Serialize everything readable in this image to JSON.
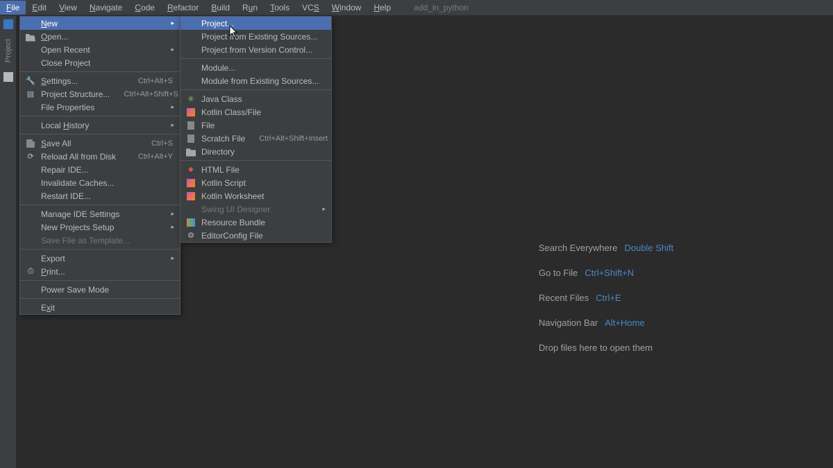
{
  "menubar": {
    "items": [
      {
        "label": "File",
        "mn": "F",
        "active": true
      },
      {
        "label": "Edit",
        "mn": "E"
      },
      {
        "label": "View",
        "mn": "V"
      },
      {
        "label": "Navigate",
        "mn": "N"
      },
      {
        "label": "Code",
        "mn": "C"
      },
      {
        "label": "Refactor",
        "mn": "R"
      },
      {
        "label": "Build",
        "mn": "B"
      },
      {
        "label": "Run",
        "mn": "u"
      },
      {
        "label": "Tools",
        "mn": "T"
      },
      {
        "label": "VCS",
        "mn": "S"
      },
      {
        "label": "Window",
        "mn": "W"
      },
      {
        "label": "Help",
        "mn": "H"
      }
    ],
    "project": "add_in_python"
  },
  "gutter": {
    "label": "Project"
  },
  "file_menu": [
    {
      "kind": "item",
      "label": "New",
      "mn": "N",
      "sub": true,
      "selected": true
    },
    {
      "kind": "item",
      "label": "Open...",
      "mn": "O",
      "icon": "folder-open"
    },
    {
      "kind": "item",
      "label": "Open Recent",
      "sub": true
    },
    {
      "kind": "item",
      "label": "Close Project"
    },
    {
      "kind": "sep"
    },
    {
      "kind": "item",
      "label": "Settings...",
      "mn": "S",
      "shortcut": "Ctrl+Alt+S",
      "icon": "wrench"
    },
    {
      "kind": "item",
      "label": "Project Structure...",
      "shortcut": "Ctrl+Alt+Shift+S",
      "icon": "stack"
    },
    {
      "kind": "item",
      "label": "File Properties",
      "sub": true
    },
    {
      "kind": "sep"
    },
    {
      "kind": "item",
      "label": "Local History",
      "mn": "H",
      "sub": true
    },
    {
      "kind": "sep"
    },
    {
      "kind": "item",
      "label": "Save All",
      "shortcut": "Ctrl+S",
      "icon": "disk",
      "mn": "S"
    },
    {
      "kind": "item",
      "label": "Reload All from Disk",
      "shortcut": "Ctrl+Alt+Y",
      "icon": "reload"
    },
    {
      "kind": "item",
      "label": "Repair IDE..."
    },
    {
      "kind": "item",
      "label": "Invalidate Caches..."
    },
    {
      "kind": "item",
      "label": "Restart IDE..."
    },
    {
      "kind": "sep"
    },
    {
      "kind": "item",
      "label": "Manage IDE Settings",
      "sub": true
    },
    {
      "kind": "item",
      "label": "New Projects Setup",
      "sub": true
    },
    {
      "kind": "item",
      "label": "Save File as Template...",
      "disabled": true
    },
    {
      "kind": "sep"
    },
    {
      "kind": "item",
      "label": "Export",
      "sub": true
    },
    {
      "kind": "item",
      "label": "Print...",
      "mn": "P",
      "icon": "print"
    },
    {
      "kind": "sep"
    },
    {
      "kind": "item",
      "label": "Power Save Mode"
    },
    {
      "kind": "sep"
    },
    {
      "kind": "item",
      "label": "Exit",
      "mn": "x"
    }
  ],
  "new_menu": [
    {
      "kind": "item",
      "label": "Project...",
      "selected": true
    },
    {
      "kind": "item",
      "label": "Project from Existing Sources..."
    },
    {
      "kind": "item",
      "label": "Project from Version Control..."
    },
    {
      "kind": "sep"
    },
    {
      "kind": "item",
      "label": "Module..."
    },
    {
      "kind": "item",
      "label": "Module from Existing Sources..."
    },
    {
      "kind": "sep"
    },
    {
      "kind": "item",
      "label": "Java Class",
      "icon": "java"
    },
    {
      "kind": "item",
      "label": "Kotlin Class/File",
      "icon": "kotlin"
    },
    {
      "kind": "item",
      "label": "File",
      "icon": "file"
    },
    {
      "kind": "item",
      "label": "Scratch File",
      "shortcut": "Ctrl+Alt+Shift+Insert",
      "icon": "file"
    },
    {
      "kind": "item",
      "label": "Directory",
      "icon": "folder"
    },
    {
      "kind": "sep"
    },
    {
      "kind": "item",
      "label": "HTML File",
      "icon": "html"
    },
    {
      "kind": "item",
      "label": "Kotlin Script",
      "icon": "kotlin"
    },
    {
      "kind": "item",
      "label": "Kotlin Worksheet",
      "icon": "kotlin"
    },
    {
      "kind": "item",
      "label": "Swing UI Designer",
      "sub": true,
      "disabled": true
    },
    {
      "kind": "item",
      "label": "Resource Bundle",
      "icon": "bundle"
    },
    {
      "kind": "item",
      "label": "EditorConfig File",
      "icon": "gear"
    }
  ],
  "welcome": [
    {
      "text": "Search Everywhere",
      "key": "Double Shift"
    },
    {
      "text": "Go to File",
      "key": "Ctrl+Shift+N"
    },
    {
      "text": "Recent Files",
      "key": "Ctrl+E"
    },
    {
      "text": "Navigation Bar",
      "key": "Alt+Home"
    },
    {
      "text": "Drop files here to open them",
      "key": ""
    }
  ]
}
